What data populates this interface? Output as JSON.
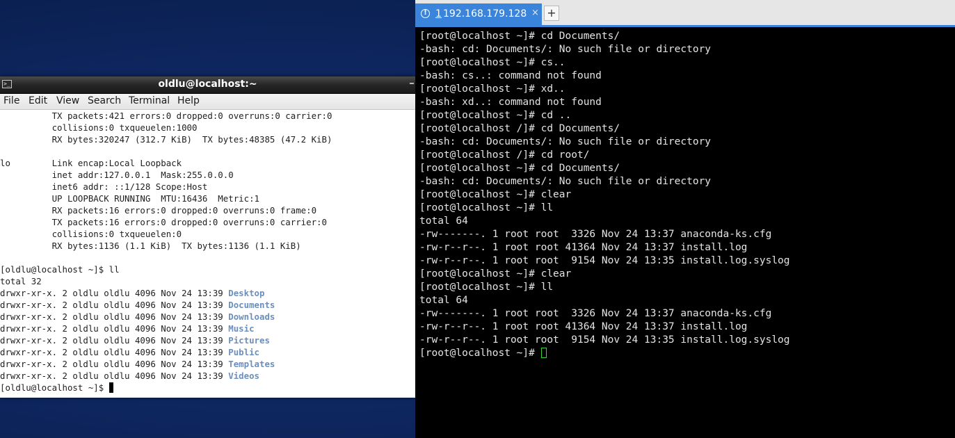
{
  "desktop": {
    "background": "#0f2862"
  },
  "left_window": {
    "title": "oldlu@localhost:~",
    "menu": [
      "File",
      "Edit",
      "View",
      "Search",
      "Terminal",
      "Help"
    ],
    "terminal_lines": [
      "          TX packets:421 errors:0 dropped:0 overruns:0 carrier:0",
      "          collisions:0 txqueuelen:1000",
      "          RX bytes:320247 (312.7 KiB)  TX bytes:48385 (47.2 KiB)",
      "",
      "lo        Link encap:Local Loopback",
      "          inet addr:127.0.0.1  Mask:255.0.0.0",
      "          inet6 addr: ::1/128 Scope:Host",
      "          UP LOOPBACK RUNNING  MTU:16436  Metric:1",
      "          RX packets:16 errors:0 dropped:0 overruns:0 frame:0",
      "          TX packets:16 errors:0 dropped:0 overruns:0 carrier:0",
      "          collisions:0 txqueuelen:0",
      "          RX bytes:1136 (1.1 KiB)  TX bytes:1136 (1.1 KiB)",
      "",
      "[oldlu@localhost ~]$ ll",
      "total 32"
    ],
    "dir_listing": [
      {
        "prefix": "drwxr-xr-x. 2 oldlu oldlu 4096 Nov 24 13:39 ",
        "name": "Desktop"
      },
      {
        "prefix": "drwxr-xr-x. 2 oldlu oldlu 4096 Nov 24 13:39 ",
        "name": "Documents"
      },
      {
        "prefix": "drwxr-xr-x. 2 oldlu oldlu 4096 Nov 24 13:39 ",
        "name": "Downloads"
      },
      {
        "prefix": "drwxr-xr-x. 2 oldlu oldlu 4096 Nov 24 13:39 ",
        "name": "Music"
      },
      {
        "prefix": "drwxr-xr-x. 2 oldlu oldlu 4096 Nov 24 13:39 ",
        "name": "Pictures"
      },
      {
        "prefix": "drwxr-xr-x. 2 oldlu oldlu 4096 Nov 24 13:39 ",
        "name": "Public"
      },
      {
        "prefix": "drwxr-xr-x. 2 oldlu oldlu 4096 Nov 24 13:39 ",
        "name": "Templates"
      },
      {
        "prefix": "drwxr-xr-x. 2 oldlu oldlu 4096 Nov 24 13:39 ",
        "name": "Videos"
      }
    ],
    "prompt": "[oldlu@localhost ~]$ ",
    "dir_color": "#6b8fbd"
  },
  "right_window": {
    "tab": {
      "index": "1",
      "host": " 192.168.179.128",
      "close": "×",
      "alert_icon": "!"
    },
    "add_tab_label": "+",
    "accent_color": "#3a84dc",
    "terminal_lines": [
      "[root@localhost ~]# cd Documents/",
      "-bash: cd: Documents/: No such file or directory",
      "[root@localhost ~]# cs..",
      "-bash: cs..: command not found",
      "[root@localhost ~]# xd..",
      "-bash: xd..: command not found",
      "[root@localhost ~]# cd ..",
      "[root@localhost /]# cd Documents/",
      "-bash: cd: Documents/: No such file or directory",
      "[root@localhost /]# cd root/",
      "[root@localhost ~]# cd Documents/",
      "-bash: cd: Documents/: No such file or directory",
      "[root@localhost ~]# clear",
      "[root@localhost ~]# ll",
      "total 64",
      "-rw-------. 1 root root  3326 Nov 24 13:37 anaconda-ks.cfg",
      "-rw-r--r--. 1 root root 41364 Nov 24 13:37 install.log",
      "-rw-r--r--. 1 root root  9154 Nov 24 13:35 install.log.syslog",
      "[root@localhost ~]# clear",
      "[root@localhost ~]# ll",
      "total 64",
      "-rw-------. 1 root root  3326 Nov 24 13:37 anaconda-ks.cfg",
      "-rw-r--r--. 1 root root 41364 Nov 24 13:37 install.log",
      "-rw-r--r--. 1 root root  9154 Nov 24 13:35 install.log.syslog"
    ],
    "prompt": "[root@localhost ~]# ",
    "cursor_color": "#34d634"
  }
}
